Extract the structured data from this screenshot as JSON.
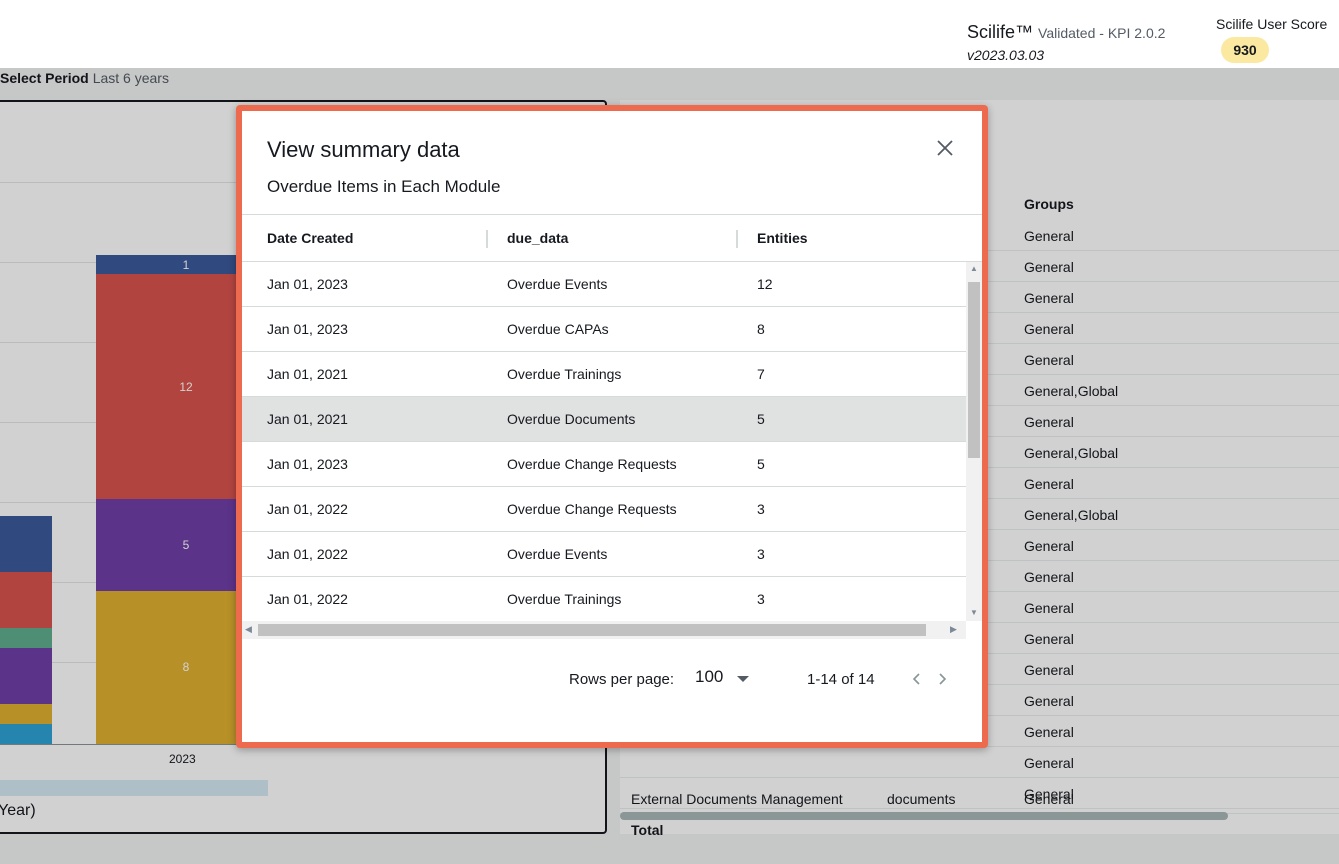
{
  "header": {
    "brand": "Scilife™",
    "brand_sub": "Validated - KPI 2.0.2",
    "version": "v2023.03.03",
    "score_label": "Scilife User Score",
    "score_value": "930"
  },
  "dashboard": {
    "period_label": "Select Period",
    "period_value": "Last 6 years",
    "chart": {
      "bar_labels": [
        "1",
        "12",
        "5",
        "8"
      ],
      "x_tick": "2023",
      "x_label_partial": "Year)"
    },
    "table": {
      "groups_header": "Groups",
      "groups": [
        "General",
        "General",
        "General",
        "General",
        "General",
        "General,Global",
        "General",
        "General,Global",
        "General",
        "General,Global",
        "General",
        "General",
        "General",
        "General",
        "General",
        "General",
        "General",
        "General",
        "General"
      ],
      "last_row": {
        "module": "External Documents Management",
        "type": "documents",
        "group": "General"
      },
      "total_label": "Total"
    }
  },
  "modal": {
    "title": "View summary data",
    "subtitle": "Overdue Items in Each Module",
    "columns": [
      "Date Created",
      "due_data",
      "Entities"
    ],
    "rows": [
      [
        "Jan 01, 2023",
        "Overdue Events",
        "12"
      ],
      [
        "Jan 01, 2023",
        "Overdue CAPAs",
        "8"
      ],
      [
        "Jan 01, 2021",
        "Overdue Trainings",
        "7"
      ],
      [
        "Jan 01, 2021",
        "Overdue Documents",
        "5"
      ],
      [
        "Jan 01, 2023",
        "Overdue Change Requests",
        "5"
      ],
      [
        "Jan 01, 2022",
        "Overdue Change Requests",
        "3"
      ],
      [
        "Jan 01, 2022",
        "Overdue Events",
        "3"
      ],
      [
        "Jan 01, 2022",
        "Overdue Trainings",
        "3"
      ]
    ],
    "selected_row_index": 3,
    "rows_per_page_label": "Rows per page:",
    "rows_per_page_value": "100",
    "range_text": "1-14 of 14"
  },
  "colors": {
    "accent_border": "#ee6a4e",
    "bar_blue": "#3b5a9a",
    "bar_red": "#d9534f",
    "bar_purple": "#6f3fa8",
    "bar_yellow": "#e0b030",
    "bar_teal": "#5fae8f",
    "bar_cyan": "#2ea3d5",
    "score_badge": "#fbe9a2"
  }
}
